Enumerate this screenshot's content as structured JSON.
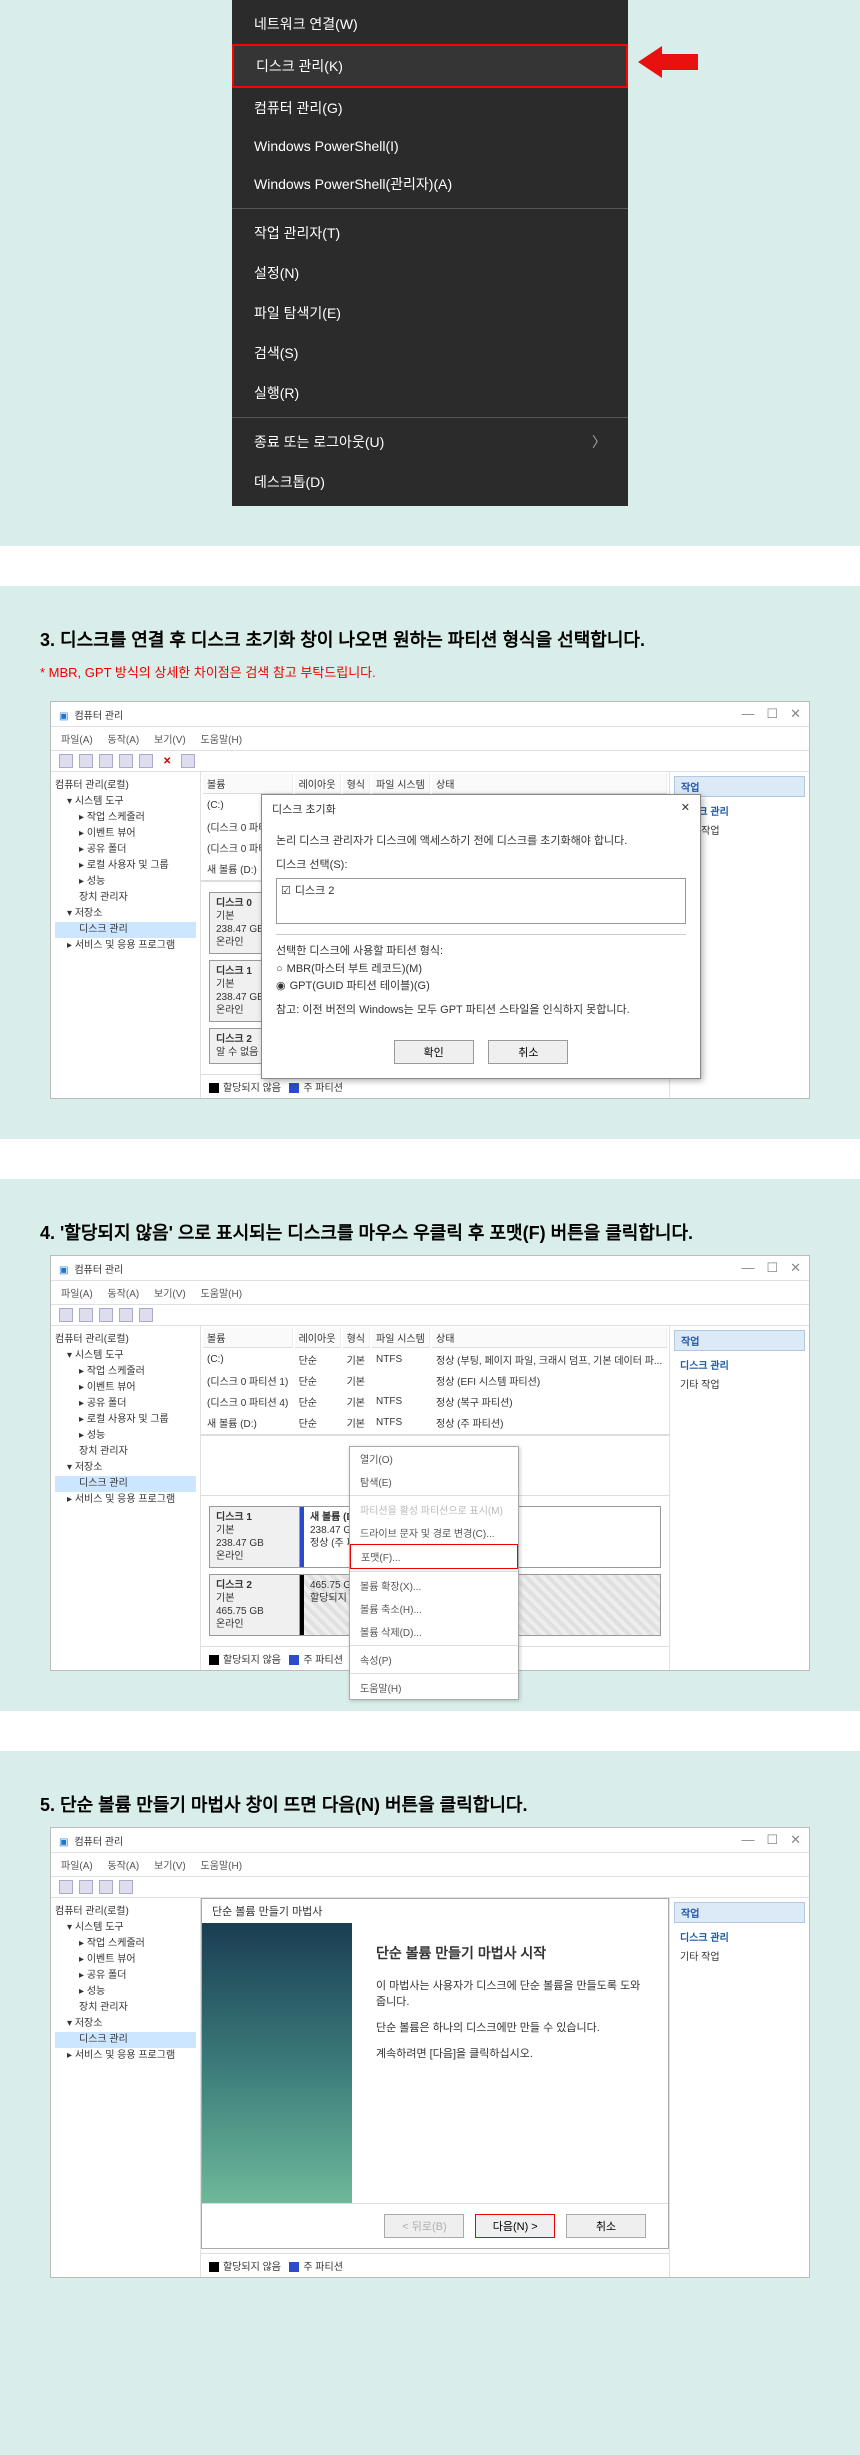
{
  "ctxmenu": {
    "items": [
      "네트워크 연결(W)",
      "디스크 관리(K)",
      "컴퓨터 관리(G)",
      "Windows PowerShell(I)",
      "Windows PowerShell(관리자)(A)"
    ],
    "group2": [
      "작업 관리자(T)",
      "설정(N)",
      "파일 탐색기(E)",
      "검색(S)",
      "실행(R)"
    ],
    "group3": [
      "종료 또는 로그아웃(U)",
      "데스크톱(D)"
    ],
    "chevron": "〉"
  },
  "step3": {
    "title": "3. 디스크를 연결 후 디스크 초기화 창이 나오면 원하는 파티션 형식을 선택합니다.",
    "note": "*  MBR, GPT 방식의 상세한 차이점은 검색 참고 부탁드립니다."
  },
  "step4": {
    "title": "4. '할당되지 않음' 으로 표시되는 디스크를 마우스 우클릭 후 포맷(F) 버튼을 클릭합니다."
  },
  "step5": {
    "title": "5. 단순 볼륨 만들기 마법사 창이 뜨면 다음(N) 버튼을 클릭합니다."
  },
  "dm": {
    "title": "컴퓨터 관리",
    "wbtns": {
      "min": "—",
      "max": "☐",
      "close": "✕"
    },
    "menu": [
      "파일(A)",
      "동작(A)",
      "보기(V)",
      "도움말(H)"
    ],
    "tree": {
      "root": "컴퓨터 관리(로컬)",
      "sys": "시스템 도구",
      "sched": "작업 스케줄러",
      "event": "이벤트 뷰어",
      "share": "공유 폴더",
      "users": "로컬 사용자 및 그룹",
      "perf": "성능",
      "devmgr": "장치 관리자",
      "storage": "저장소",
      "diskmgmt": "디스크 관리",
      "svc": "서비스 및 응용 프로그램"
    },
    "cols": [
      "볼륨",
      "레이아웃",
      "형식",
      "파일 시스템",
      "상태"
    ],
    "vols": [
      {
        "name": "(C:)",
        "layout": "단순",
        "type": "기본",
        "fs": "NTFS",
        "status": "정상 (부팅, 페이지 파일, 크래시 덤프, 기본 데이터 파..."
      },
      {
        "name": "(디스크 0 파티션 1)",
        "layout": "단순",
        "type": "기본",
        "fs": "",
        "status": "정상 (EFI 시스템 파티션)"
      },
      {
        "name": "(디스크 0 파티션 4)",
        "layout": "단순",
        "type": "기본",
        "fs": "NTFS",
        "status": "정상 (복구 파티션)"
      },
      {
        "name": "새 볼륨 (D:)",
        "layout": "단순",
        "type": "기본",
        "fs": "NTFS",
        "status": "정상 (주 파티션)"
      }
    ],
    "right": {
      "hdr": "작업",
      "sub": "디스크 관리",
      "more": "기타 작업"
    },
    "disk0": {
      "name": "디스크 0",
      "type": "기본",
      "size": "238.47 GB",
      "state": "온라인"
    },
    "disk1": {
      "name": "디스크 1",
      "type": "기본",
      "size": "238.47 GB",
      "state": "온라인",
      "vol": "새 볼륨 (D:)",
      "volsize": "238.47 GB NTFS",
      "volstatus": "정상 (주 파티션)"
    },
    "disk2": {
      "name": "디스크 2",
      "type": "기본",
      "size": "465.75 GB",
      "state": "온라인",
      "unalloc": "465.75 GB",
      "unalloc_label": "할당되지 않음",
      "unknown": "알 수 없음"
    },
    "legend": {
      "unalloc": "할당되지 않음",
      "primary": "주 파티션"
    }
  },
  "initdlg": {
    "title": "디스크 초기화",
    "close": "✕",
    "msg": "논리 디스크 관리자가 디스크에 액세스하기 전에 디스크를 초기화해야 합니다.",
    "select_label": "디스크 선택(S):",
    "disk": "디스크 2",
    "style_label": "선택한 디스크에 사용할 파티션 형식:",
    "mbr": "MBR(마스터 부트 레코드)(M)",
    "gpt": "GPT(GUID 파티션 테이블)(G)",
    "warn": "참고: 이전 버전의 Windows는 모두 GPT 파티션 스타일을 인식하지 못합니다.",
    "ok": "확인",
    "cancel": "취소"
  },
  "ctxpop": {
    "open": "열기(O)",
    "explore": "탐색(E)",
    "active": "파티션을 활성 파티션으로 표시(M)",
    "change": "드라이브 문자 및 경로 변경(C)...",
    "format": "포맷(F)...",
    "extend": "볼륨 확장(X)...",
    "shrink": "볼륨 축소(H)...",
    "delvol": "볼륨 삭제(D)...",
    "prop": "속성(P)",
    "help": "도움말(H)"
  },
  "wizard": {
    "dlg_title": "단순 볼륨 만들기 마법사",
    "title": "단순 볼륨 만들기 마법사 시작",
    "p1": "이 마법사는 사용자가 디스크에 단순 볼륨을 만들도록 도와줍니다.",
    "p2": "단순 볼륨은 하나의 디스크에만 만들 수 있습니다.",
    "p3": "계속하려면 [다음]을 클릭하십시오.",
    "back": "< 뒤로(B)",
    "next": "다음(N) >",
    "cancel": "취소"
  }
}
